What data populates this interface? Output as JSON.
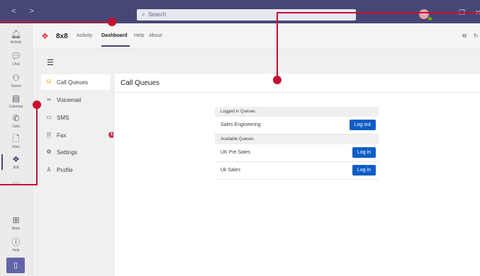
{
  "window": {
    "nav_label": "< >",
    "search_placeholder": "Search",
    "avatar_initials": "JK",
    "controls": {
      "minimize": "–",
      "restore": "❐",
      "close": "✕"
    }
  },
  "rail": {
    "items": [
      {
        "name": "Activity",
        "icon": "bell-icon"
      },
      {
        "name": "Chat",
        "icon": "chat-icon"
      },
      {
        "name": "Teams",
        "icon": "teams-icon"
      },
      {
        "name": "Calendar",
        "icon": "calendar-icon"
      },
      {
        "name": "Calls",
        "icon": "phone-icon"
      },
      {
        "name": "Files",
        "icon": "file-icon"
      },
      {
        "name": "8x8",
        "icon": "8x8-logo-icon"
      }
    ],
    "more_label": "...",
    "apps_label": "Apps",
    "help_label": "Help"
  },
  "app": {
    "name": "8x8",
    "tabs": [
      "Activity",
      "Dashboard",
      "Help",
      "About"
    ],
    "active_tab": "Dashboard"
  },
  "sidebar": {
    "items": [
      {
        "label": "Call Queues",
        "icon": "queue-icon",
        "active": true
      },
      {
        "label": "Voicemail",
        "icon": "voicemail-icon"
      },
      {
        "label": "SMS",
        "icon": "sms-icon"
      },
      {
        "label": "Fax",
        "icon": "fax-icon",
        "badge": "1"
      },
      {
        "label": "Settings",
        "icon": "gear-icon"
      },
      {
        "label": "Profile",
        "icon": "person-icon"
      }
    ]
  },
  "main": {
    "title": "Call Queues",
    "logged_in_header": "Logged in Queues",
    "logged_in": [
      {
        "name": "Sales Engineering",
        "action": "Log out"
      }
    ],
    "available_header": "Available Queues",
    "available": [
      {
        "name": "UK Pre Sales",
        "action": "Log in"
      },
      {
        "name": "Uk Sales",
        "action": "Log in"
      }
    ]
  },
  "colors": {
    "titlebar": "#464775",
    "accent": "#0f5ec5",
    "annotation": "#c50f2f",
    "brand_red": "#e03a3e"
  }
}
